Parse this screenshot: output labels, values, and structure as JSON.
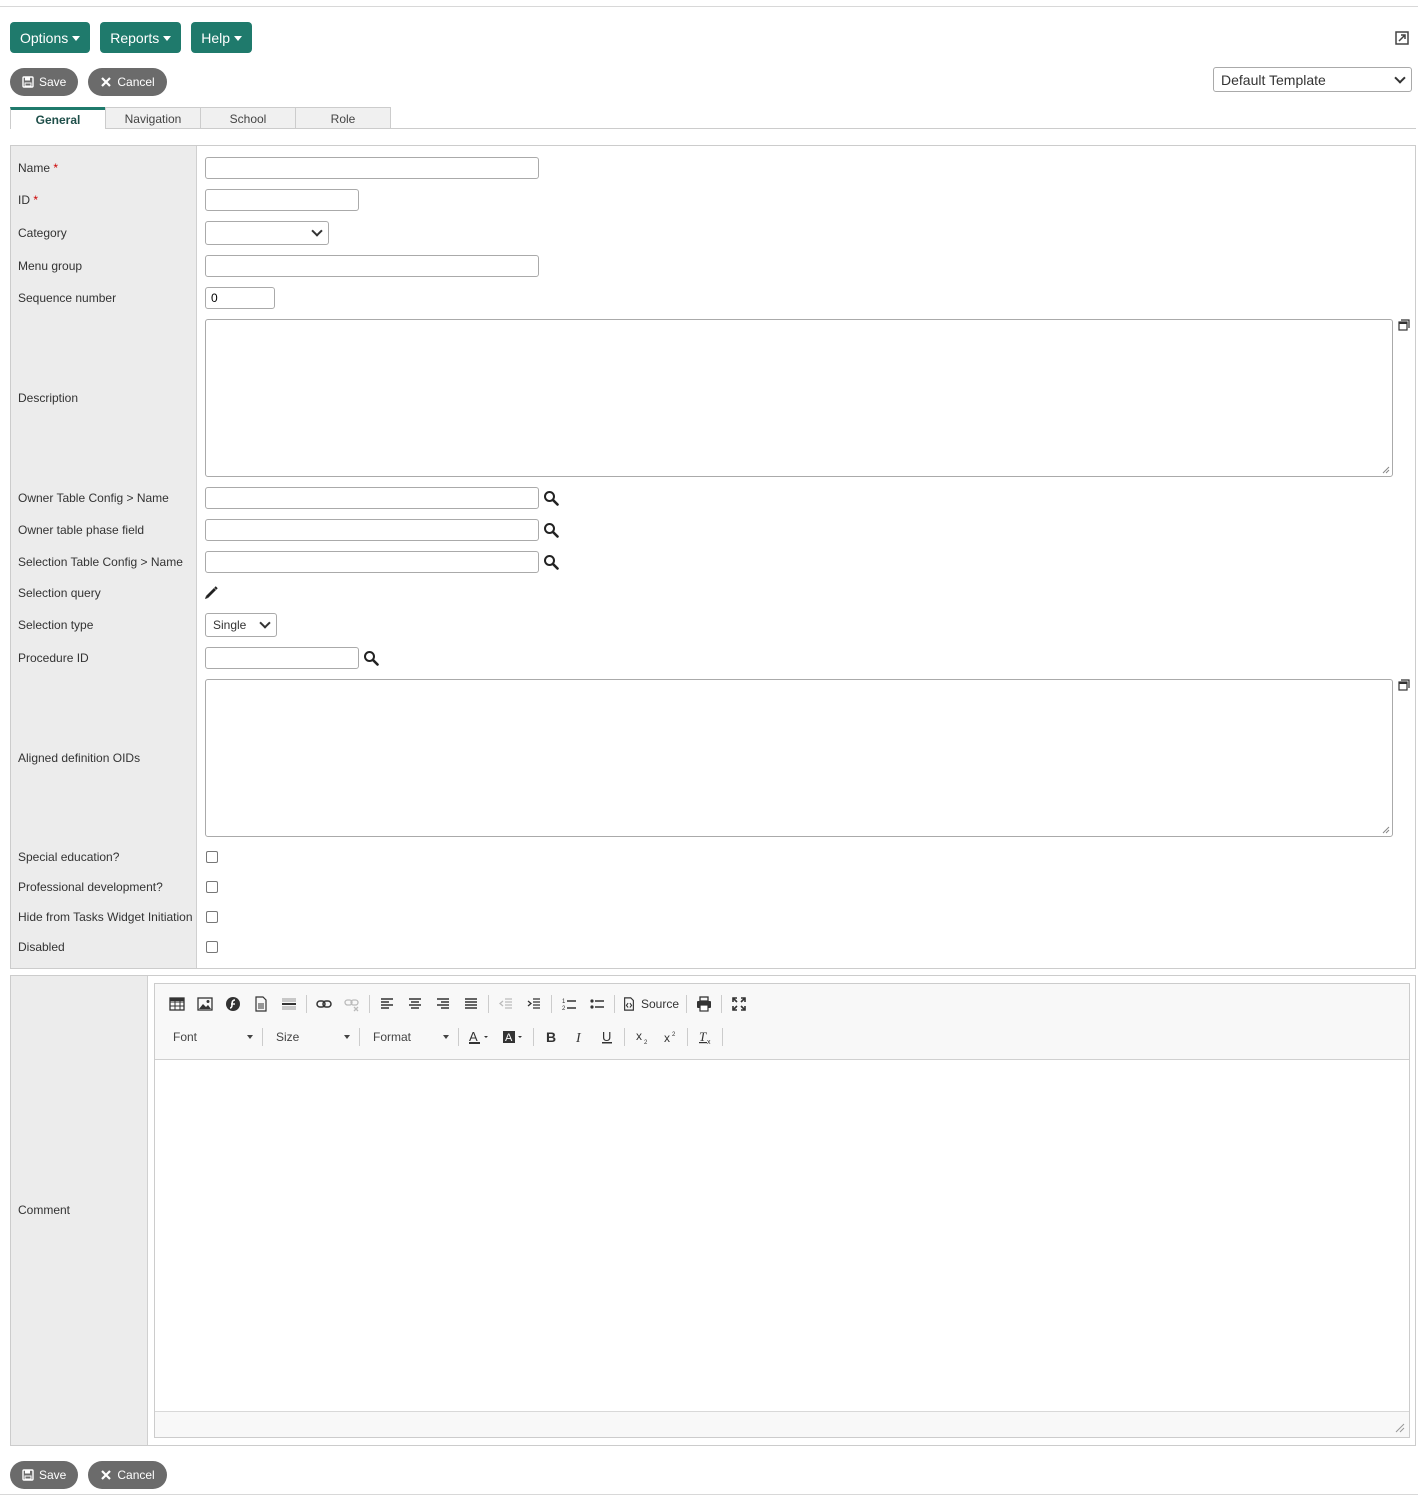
{
  "menubar": {
    "options": "Options",
    "reports": "Reports",
    "help": "Help"
  },
  "actions": {
    "save": "Save",
    "cancel": "Cancel"
  },
  "template_select": {
    "value": "Default Template"
  },
  "tabs": [
    {
      "label": "General",
      "active": true
    },
    {
      "label": "Navigation",
      "active": false
    },
    {
      "label": "School",
      "active": false
    },
    {
      "label": "Role",
      "active": false
    }
  ],
  "form": {
    "required_marker": "*",
    "name": {
      "label": "Name",
      "value": ""
    },
    "id": {
      "label": "ID",
      "value": ""
    },
    "category": {
      "label": "Category",
      "value": ""
    },
    "menu_group": {
      "label": "Menu group",
      "value": ""
    },
    "sequence_number": {
      "label": "Sequence number",
      "value": "0"
    },
    "description": {
      "label": "Description",
      "value": ""
    },
    "owner_table_config": {
      "label": "Owner Table Config > Name",
      "value": ""
    },
    "owner_table_phase": {
      "label": "Owner table phase field",
      "value": ""
    },
    "selection_table_config": {
      "label": "Selection Table Config > Name",
      "value": ""
    },
    "selection_query": {
      "label": "Selection query"
    },
    "selection_type": {
      "label": "Selection type",
      "value": "Single"
    },
    "procedure_id": {
      "label": "Procedure ID",
      "value": ""
    },
    "aligned_definition_oids": {
      "label": "Aligned definition OIDs",
      "value": ""
    },
    "special_education": {
      "label": "Special education?",
      "checked": false
    },
    "professional_development": {
      "label": "Professional development?",
      "checked": false
    },
    "hide_from_tasks": {
      "label": "Hide from Tasks Widget Initiation",
      "checked": false
    },
    "disabled": {
      "label": "Disabled",
      "checked": false
    }
  },
  "comment": {
    "label": "Comment",
    "toolbar": {
      "source": "Source",
      "font": "Font",
      "size": "Size",
      "format": "Format"
    }
  },
  "colors": {
    "accent": "#1f7a6c",
    "action_button": "#6b6b6b",
    "label_bg": "#ececec"
  }
}
